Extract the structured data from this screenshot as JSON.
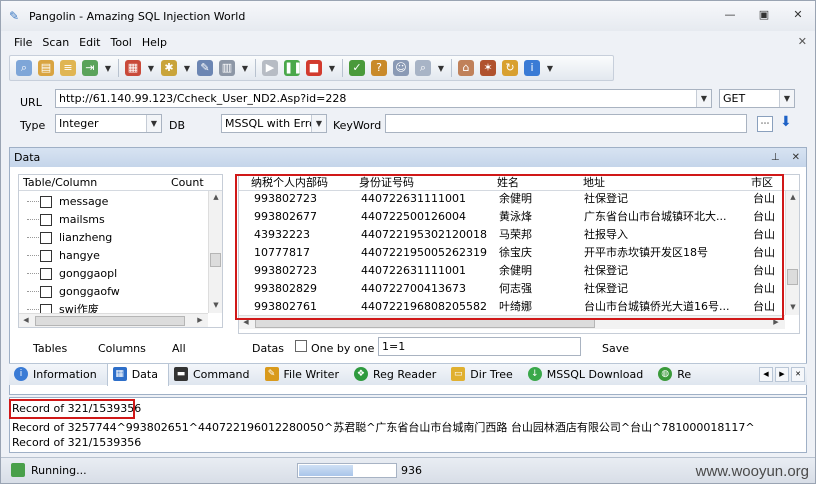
{
  "window": {
    "title": "Pangolin - Amazing SQL Injection World"
  },
  "menu": {
    "items": [
      "File",
      "Scan",
      "Edit",
      "Tool",
      "Help"
    ]
  },
  "url_panel": {
    "url_label": "URL",
    "url_value": "http://61.140.99.123/Ccheck_User_ND2.Asp?id=228",
    "method": "GET",
    "type_label": "Type",
    "type_value": "Integer",
    "db_label": "DB",
    "db_value": "MSSQL with Error",
    "keyword_label": "KeyWord",
    "keyword_value": ""
  },
  "data_panel": {
    "title": "Data",
    "left": {
      "col_table": "Table/Column",
      "col_count": "Count",
      "tables": [
        "message",
        "mailsms",
        "lianzheng",
        "hangye",
        "gonggaopl",
        "gonggaofw",
        "swj作废"
      ]
    },
    "left_footer": {
      "tables": "Tables",
      "columns": "Columns",
      "all": "All"
    },
    "grid": {
      "headers": [
        "纳税个人内部码",
        "身份证号码",
        "姓名",
        "地址",
        "市区"
      ],
      "rows": [
        [
          "993802723",
          "440722631111001",
          "余健明",
          "社保登记",
          "台山"
        ],
        [
          "993802677",
          "440722500126004",
          "黄泳烽",
          "广东省台山市台城镇环北大...",
          "台山"
        ],
        [
          "43932223",
          "440722195302120018",
          "马荣邦",
          "社报导入",
          "台山"
        ],
        [
          "10777817",
          "440722195005262319",
          "徐宝庆",
          "开平市赤坎镇开发区18号",
          "台山"
        ],
        [
          "993802723",
          "440722631111001",
          "余健明",
          "社保登记",
          "台山"
        ],
        [
          "993802829",
          "440722700413673",
          "何志强",
          "社保登记",
          "台山"
        ],
        [
          "993802761",
          "440722196808205582",
          "叶绮娜",
          "台山市台城镇侨光大道16号...",
          "台山"
        ]
      ]
    },
    "footer": {
      "datas": "Datas",
      "one_by_one": "One by one",
      "where_value": "1=1",
      "save": "Save"
    }
  },
  "tabs": [
    {
      "label": "Information",
      "icon": "info-icon",
      "color": "#3a7bd5"
    },
    {
      "label": "Data",
      "icon": "data-icon",
      "color": "#2e6fc9"
    },
    {
      "label": "Command",
      "icon": "command-icon",
      "color": "#333333"
    },
    {
      "label": "File Writer",
      "icon": "file-writer-icon",
      "color": "#d99a1c"
    },
    {
      "label": "Reg Reader",
      "icon": "reg-reader-icon",
      "color": "#2e9a3e"
    },
    {
      "label": "Dir Tree",
      "icon": "folder-icon",
      "color": "#e0b030"
    },
    {
      "label": "MSSQL Download",
      "icon": "download-icon",
      "color": "#3aa84a"
    },
    {
      "label": "Re",
      "icon": "globe-icon",
      "color": "#3a9a3a"
    }
  ],
  "log": {
    "line1": "Record of 321/1539356",
    "line2": "Record of 3257744^993802651^440722196012280050^苏君聪^广东省台山市台城南门西路  台山园林酒店有限公司^台山^781000018117^",
    "line3": "Record of 321/1539356"
  },
  "status": {
    "text": "Running...",
    "count": "936",
    "progress": 0.55,
    "watermark": "www.wooyun.org"
  }
}
